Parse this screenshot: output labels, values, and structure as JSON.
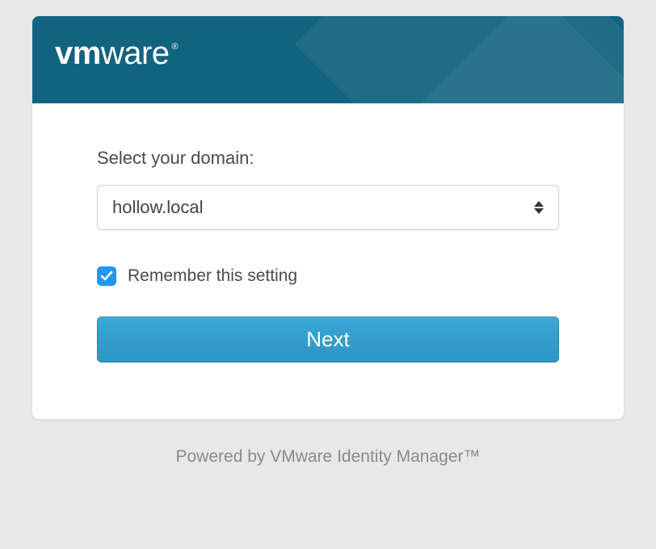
{
  "brand": {
    "bold": "vm",
    "light": "ware",
    "reg": "®"
  },
  "form": {
    "domain_label": "Select your domain:",
    "domain_value": "hollow.local",
    "remember_label": "Remember this setting",
    "remember_checked": true,
    "next_label": "Next"
  },
  "footer": {
    "text": "Powered by VMware Identity Manager™"
  },
  "colors": {
    "header_bg": "#12637f",
    "button_bg": "#2e94c4",
    "checkbox_bg": "#2196f3"
  }
}
